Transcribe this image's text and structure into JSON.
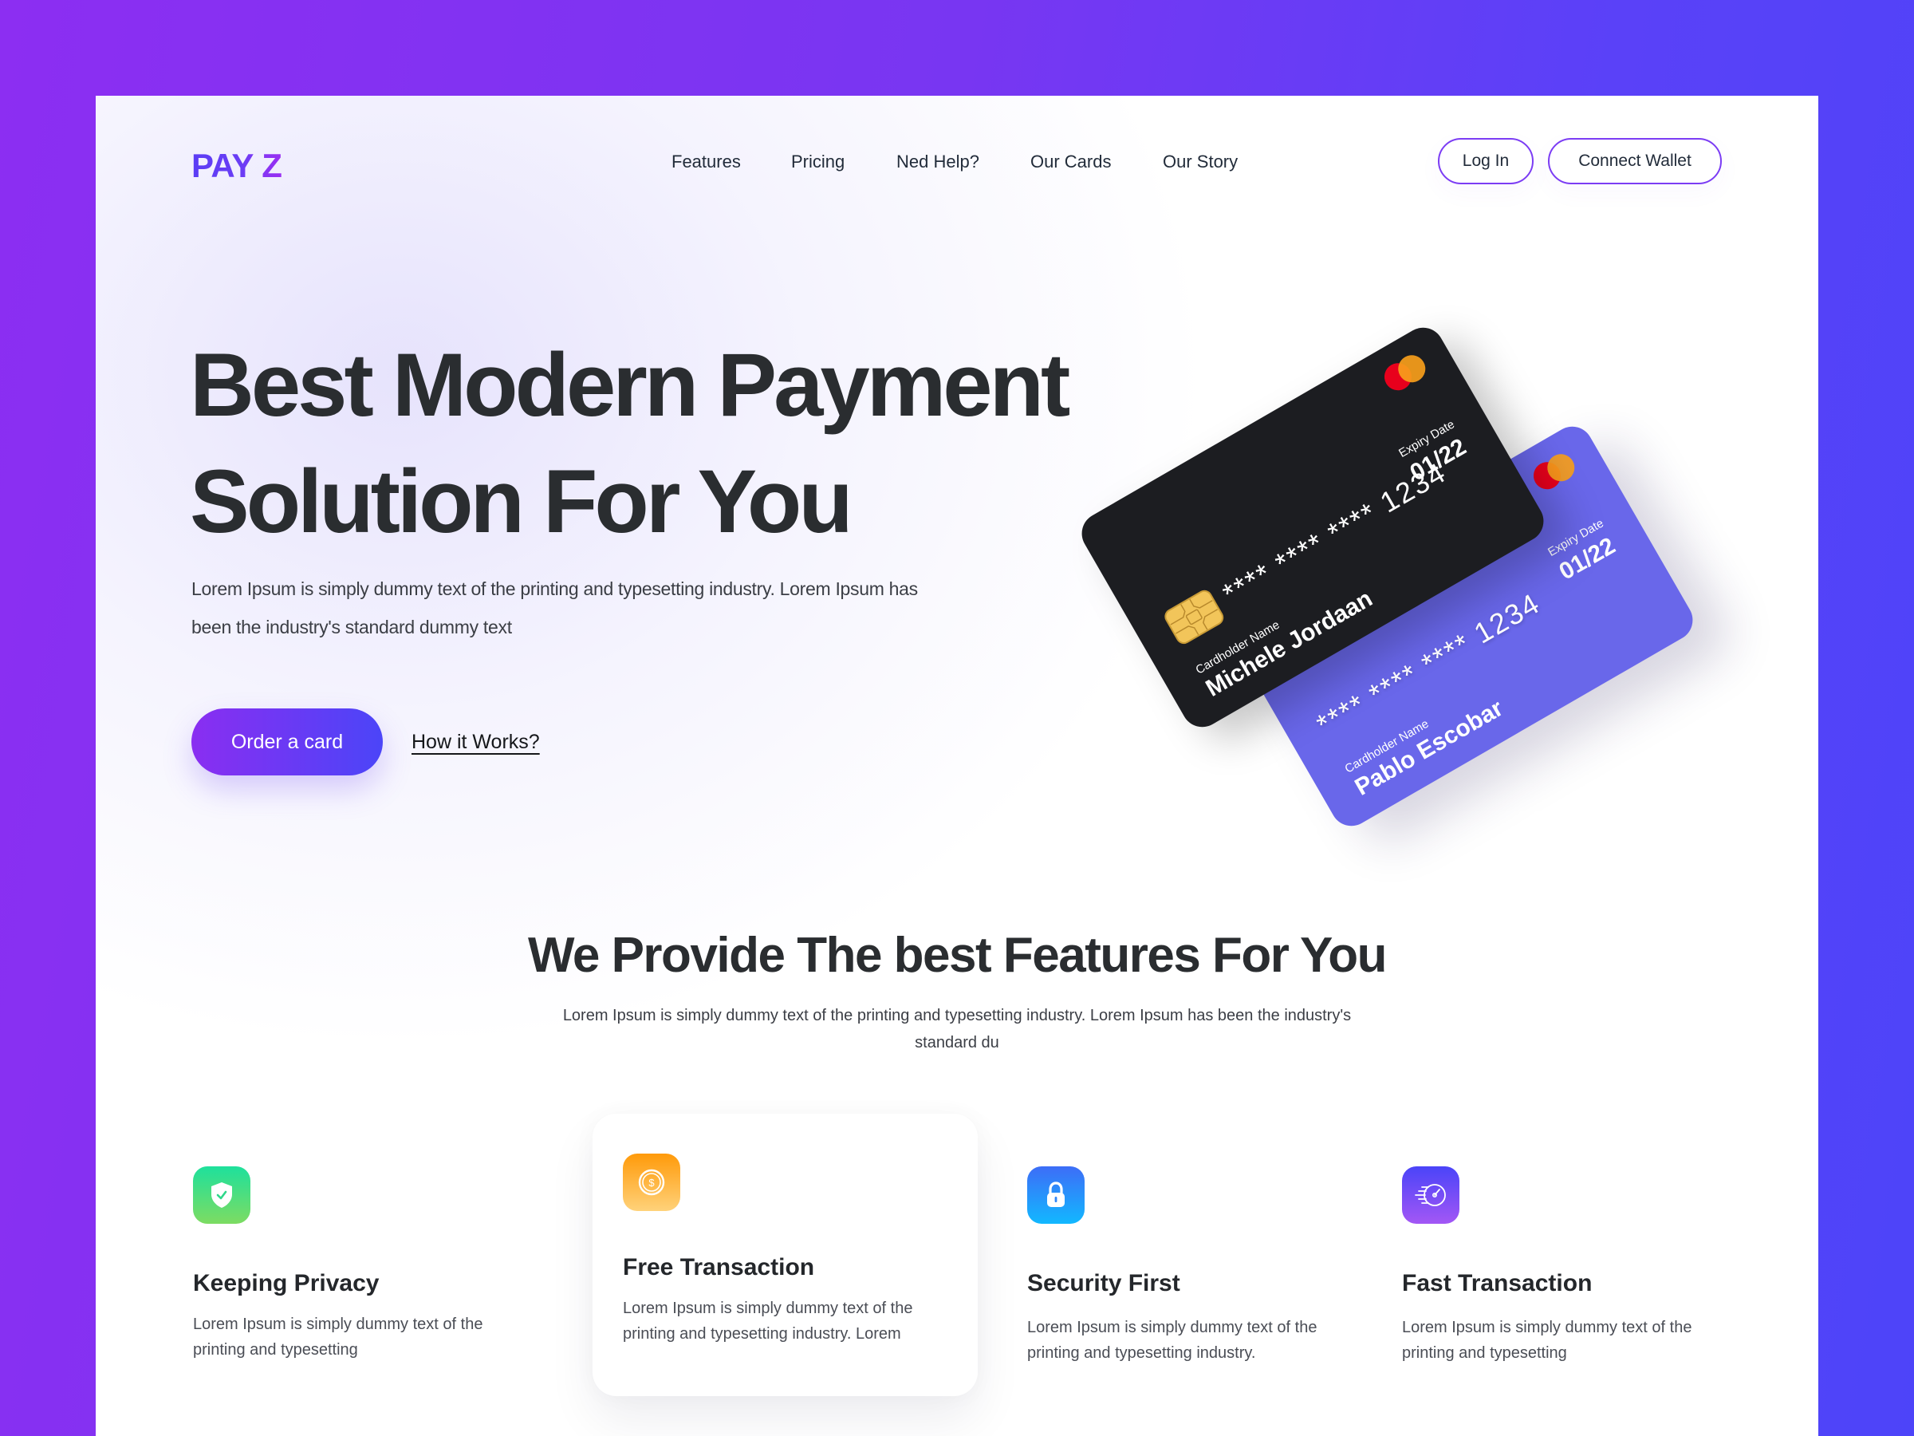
{
  "brand": {
    "logo": "PAY Z",
    "colors": {
      "gradient_start": "#8c2ef2",
      "gradient_end": "#4d44f9",
      "text_dark": "#2a2d30",
      "card_black": "#1c1d21",
      "card_purple": "#6967ea"
    }
  },
  "nav": {
    "items": [
      {
        "label": "Features"
      },
      {
        "label": "Pricing"
      },
      {
        "label": "Ned Help?"
      },
      {
        "label": "Our Cards"
      },
      {
        "label": "Our Story"
      }
    ],
    "login_label": "Log In",
    "connect_label": "Connect Wallet"
  },
  "hero": {
    "headline_line1": "Best Modern Payment",
    "headline_line2": "Solution For You",
    "text": "Lorem Ipsum is simply dummy text of the printing and typesetting industry. Lorem Ipsum has been the industry's standard dummy text",
    "primary_cta": "Order a card",
    "secondary_cta": "How it Works?"
  },
  "cards": [
    {
      "style": "black",
      "number": "**** **** **** 1234",
      "expiry_label": "Expiry Date",
      "expiry": "01/22",
      "holder_label": "Cardholder Name",
      "holder": "Michele Jordaan",
      "brand_icon": "mastercard-icon",
      "has_chip": true
    },
    {
      "style": "purple",
      "number": "**** **** **** 1234",
      "expiry_label": "Expiry Date",
      "expiry": "01/22",
      "holder_label": "Cardholder Name",
      "holder": "Pablo Escobar",
      "brand_icon": "mastercard-icon",
      "has_chip": false
    }
  ],
  "features": {
    "title": "We Provide The best Features For You",
    "subtitle": "Lorem Ipsum is simply dummy text of the printing and typesetting industry. Lorem Ipsum has been the industry's standard du",
    "items": [
      {
        "icon": "shield-check-icon",
        "title": "Keeping Privacy",
        "desc": "Lorem Ipsum is simply dummy text of the printing and typesetting",
        "color_top": "#1ee09c",
        "color_bottom": "#7ddc62"
      },
      {
        "icon": "dollar-coin-icon",
        "title": "Free Transaction",
        "desc": "Lorem Ipsum is simply dummy text of the printing and typesetting industry. Lorem",
        "color_top": "#ff9a0a",
        "color_bottom": "#ffd27a",
        "highlighted": true
      },
      {
        "icon": "lock-icon",
        "title": "Security First",
        "desc": "Lorem Ipsum is simply dummy text of the printing and typesetting industry.",
        "color_top": "#3d6df7",
        "color_bottom": "#12b8ff"
      },
      {
        "icon": "speedometer-icon",
        "title": "Fast Transaction",
        "desc": "Lorem Ipsum is simply dummy text of the printing and typesetting",
        "color_top": "#4a44f8",
        "color_bottom": "#a357f5"
      }
    ]
  }
}
